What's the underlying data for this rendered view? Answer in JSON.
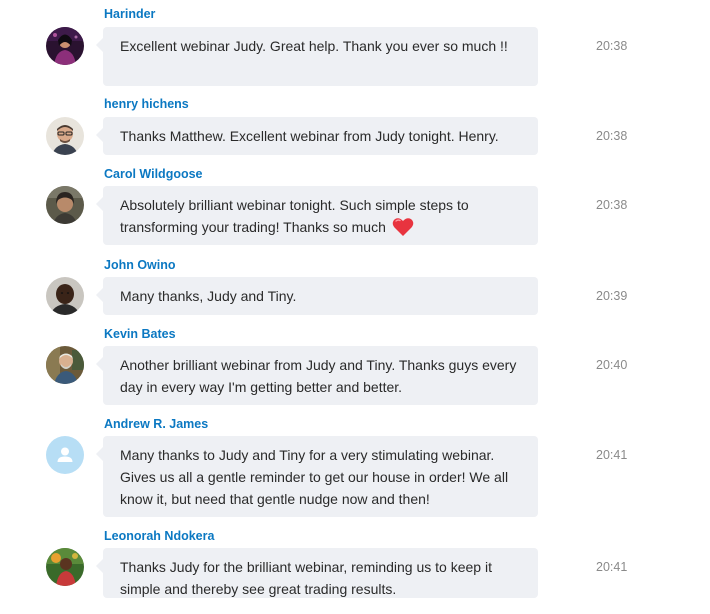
{
  "messages": [
    {
      "sender": "Harinder",
      "text": "Excellent webinar Judy. Great help. Thank you ever so much !!",
      "time": "20:38",
      "avatar": "photo"
    },
    {
      "sender": "henry hichens",
      "text": "Thanks Matthew. Excellent webinar from Judy tonight. Henry.",
      "time": "20:38",
      "avatar": "photo"
    },
    {
      "sender": "Carol Wildgoose",
      "text": "Absolutely brilliant webinar tonight. Such simple steps to transforming your trading! Thanks so much",
      "emoji": "heart-emoji",
      "time": "20:38",
      "avatar": "photo"
    },
    {
      "sender": "John Owino",
      "text": "Many thanks, Judy and Tiny.",
      "time": "20:39",
      "avatar": "photo"
    },
    {
      "sender": "Kevin Bates",
      "text": "Another brilliant webinar from Judy and Tiny. Thanks guys every day in every way I'm getting better and better.",
      "time": "20:40",
      "avatar": "photo"
    },
    {
      "sender": "Andrew R. James",
      "text": "Many thanks to Judy and Tiny for a very stimulating webinar. Gives us all a gentle reminder to get our house in order!  We all know it, but need that gentle nudge now and then!",
      "time": "20:41",
      "avatar": "default-user-icon"
    },
    {
      "sender": "Leonorah Ndokera",
      "text": "Thanks Judy for the brilliant webinar, reminding us to keep it simple and thereby see great trading results.",
      "time": "20:41",
      "avatar": "photo"
    }
  ],
  "colors": {
    "sender_name": "#0b78c2",
    "bubble_bg": "#eef0f4",
    "message_text": "#2a2a2a",
    "timestamp": "#8a8a8a",
    "default_avatar_bg": "#b7def5"
  }
}
